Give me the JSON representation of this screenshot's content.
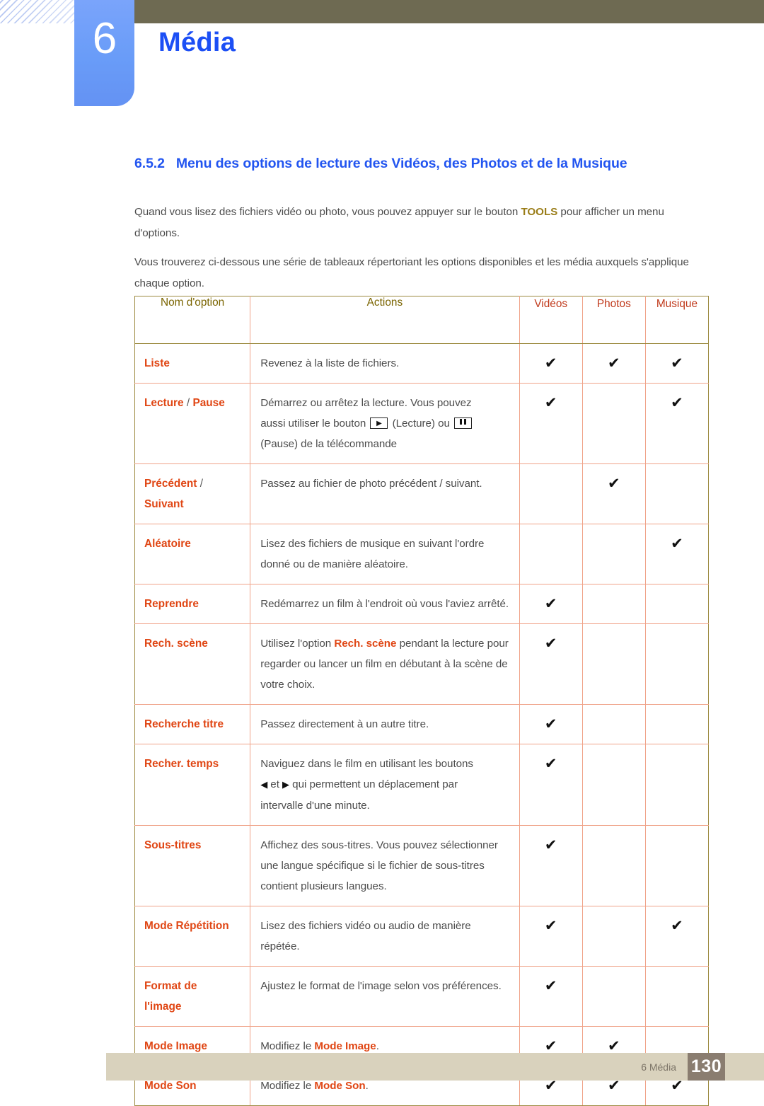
{
  "header": {
    "chapter_number": "6",
    "chapter_title": "Média",
    "accent_blue": "#1c4ff5",
    "badge_blue": "#6c9cf7",
    "olive_bar": "#6e6a52"
  },
  "section": {
    "number": "6.5.2",
    "title": "Menu des options de lecture des Vidéos, des Photos et de la Musique",
    "paragraph_1_before": "Quand vous lisez des fichiers vidéo ou photo, vous pouvez appuyer sur le bouton ",
    "paragraph_1_keyword": "TOOLS",
    "paragraph_1_after": " pour afficher un menu d'options.",
    "paragraph_2": "Vous trouverez ci-dessous une série de tableaux répertoriant les options disponibles et les média auxquels s'applique chaque option."
  },
  "table": {
    "headers": {
      "name": "Nom d'option",
      "actions": "Actions",
      "videos": "Vidéos",
      "photos": "Photos",
      "music": "Musique"
    },
    "rows": [
      {
        "name": "Liste",
        "action": "Revenez à la liste de fichiers.",
        "videos": "✔",
        "photos": "✔",
        "music": "✔"
      },
      {
        "name_part1": "Lecture",
        "name_sep": " / ",
        "name_part2": "Pause",
        "action_line1": "Démarrez ou arrêtez la lecture. Vous pouvez",
        "action_line2a": "aussi utiliser le bouton ",
        "action_line2b": " (Lecture) ou ",
        "action_line3": "(Pause) de la télécommande",
        "videos": "✔",
        "photos": "",
        "music": "✔"
      },
      {
        "name_part1": "Précédent",
        "name_sep": " /",
        "name_part2": "Suivant",
        "action": "Passez au fichier de photo précédent / suivant.",
        "videos": "",
        "photos": "✔",
        "music": ""
      },
      {
        "name": "Aléatoire",
        "action": "Lisez des fichiers de musique en suivant l'ordre donné ou de manière aléatoire.",
        "videos": "",
        "photos": "",
        "music": "✔"
      },
      {
        "name": "Reprendre",
        "action": "Redémarrez un film à l'endroit où vous l'aviez arrêté.",
        "videos": "✔",
        "photos": "",
        "music": ""
      },
      {
        "name": "Rech. scène",
        "action_before": "Utilisez l'option ",
        "action_keyword": "Rech. scène",
        "action_after": " pendant la lecture pour regarder ou lancer un film en débutant à la scène de votre choix.",
        "videos": "✔",
        "photos": "",
        "music": ""
      },
      {
        "name": "Recherche titre",
        "action": "Passez directement à un autre titre.",
        "videos": "✔",
        "photos": "",
        "music": ""
      },
      {
        "name": "Recher. temps",
        "action_line1": "Naviguez dans le film en utilisant les boutons",
        "action_arrow_left": "◀",
        "action_mid": " et ",
        "action_arrow_right": "▶",
        "action_line2b": " qui permettent un déplacement par",
        "action_line3": "intervalle d'une minute.",
        "videos": "✔",
        "photos": "",
        "music": ""
      },
      {
        "name": "Sous-titres",
        "action": "Affichez des sous-titres. Vous pouvez sélectionner une langue spécifique si le fichier de sous-titres contient plusieurs langues.",
        "videos": "✔",
        "photos": "",
        "music": ""
      },
      {
        "name": "Mode Répétition",
        "action": "Lisez des fichiers vidéo ou audio de manière répétée.",
        "videos": "✔",
        "photos": "",
        "music": "✔"
      },
      {
        "name_part1": "Format de",
        "name_part2": "l'image",
        "action": "Ajustez le format de l'image selon vos préférences.",
        "videos": "✔",
        "photos": "",
        "music": ""
      },
      {
        "name": "Mode Image",
        "action_before": "Modifiez le ",
        "action_keyword": "Mode Image",
        "action_after": ".",
        "videos": "✔",
        "photos": "✔",
        "music": ""
      },
      {
        "name": "Mode Son",
        "action_before": "Modifiez le ",
        "action_keyword": "Mode Son",
        "action_after": ".",
        "videos": "✔",
        "photos": "✔",
        "music": "✔"
      }
    ]
  },
  "footer": {
    "chapter_label": "6 Média",
    "page_number": "130"
  }
}
